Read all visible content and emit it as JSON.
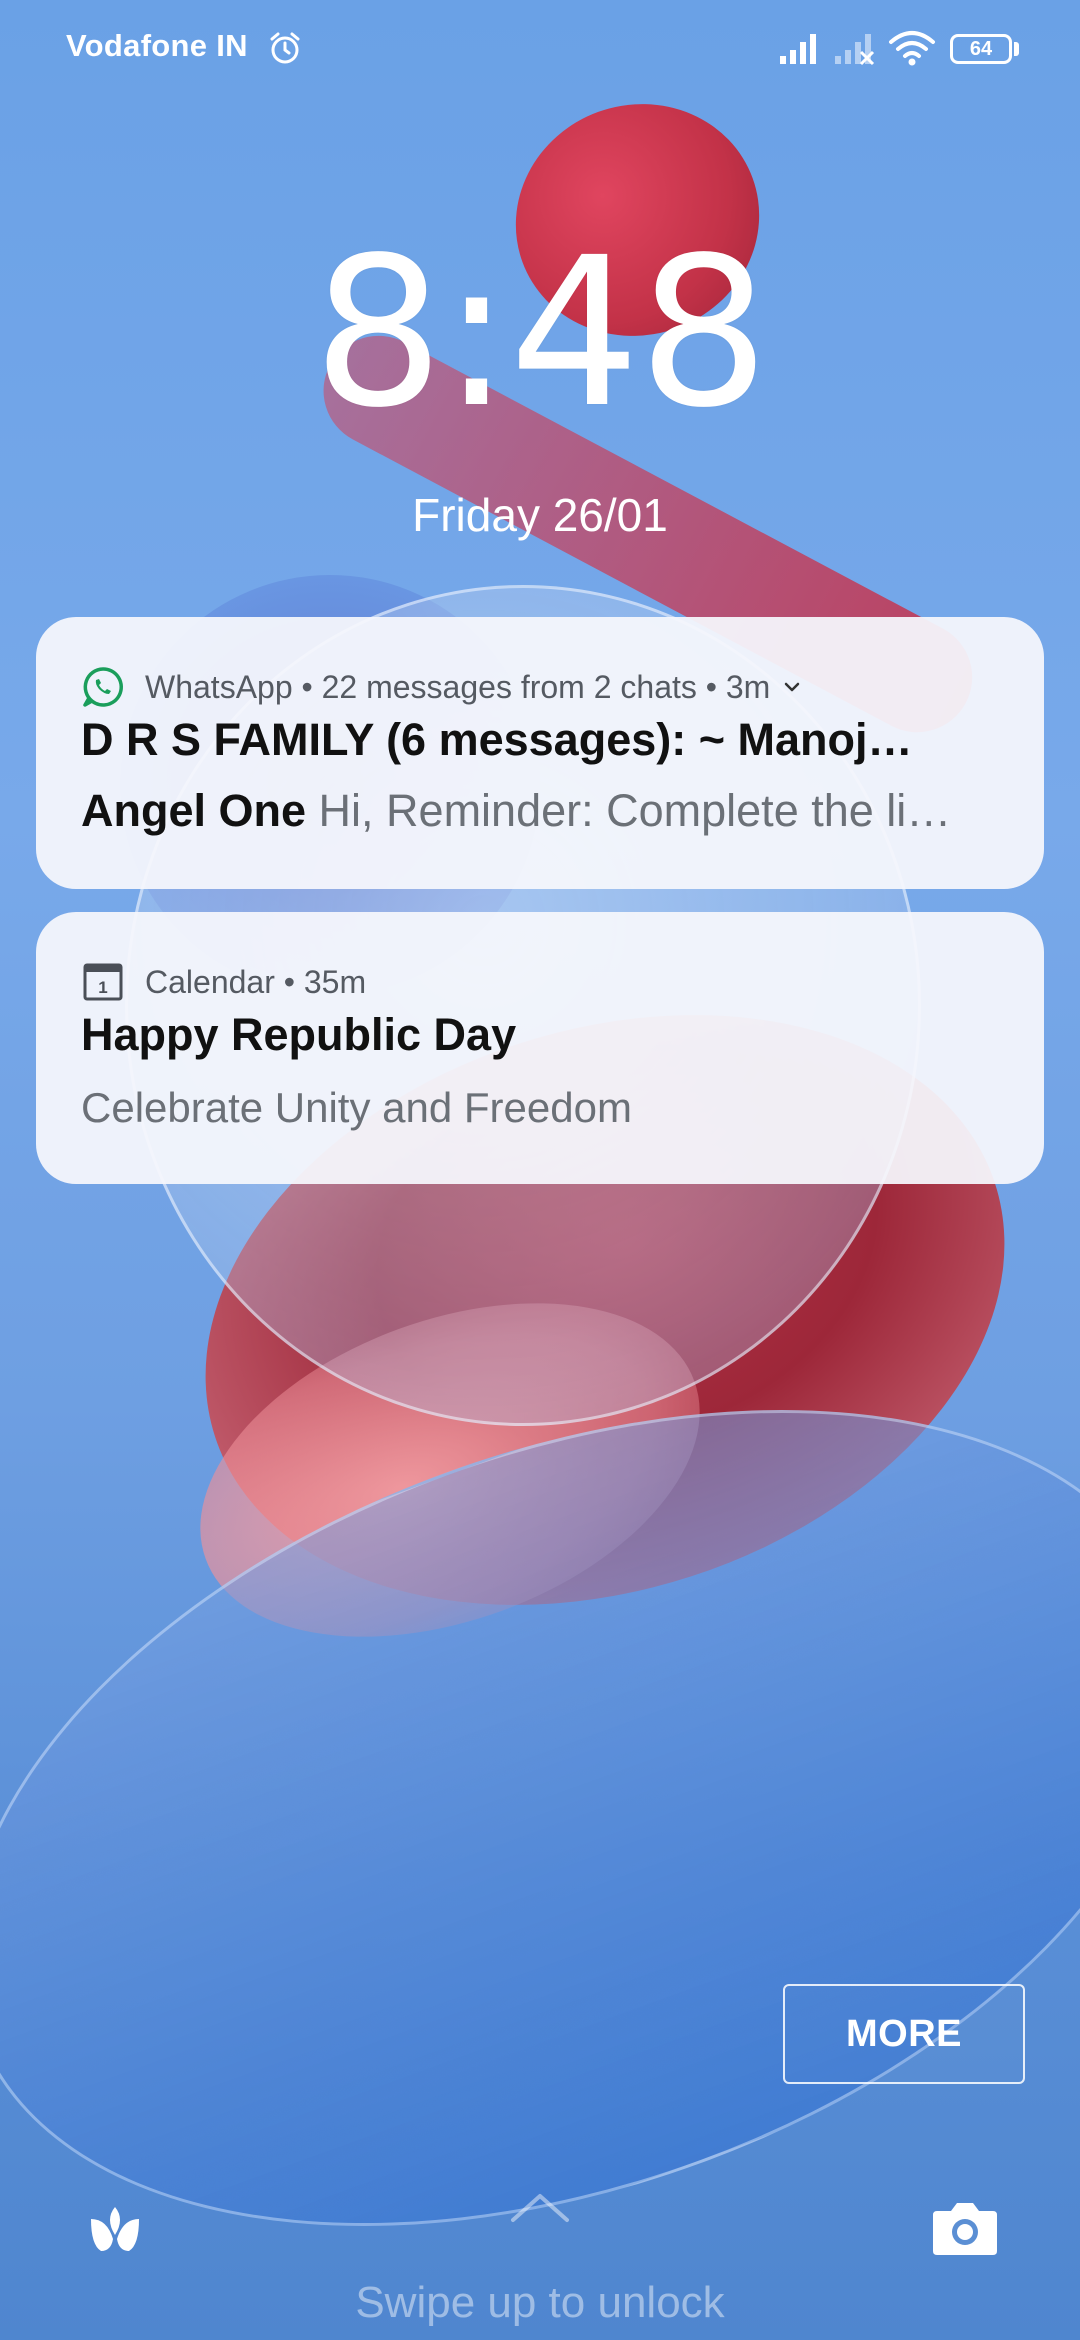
{
  "status_bar": {
    "carrier": "Vodafone IN",
    "battery": "64",
    "icons": [
      "alarm-icon",
      "signal-icon",
      "signal-no-service-icon",
      "wifi-icon",
      "battery-icon"
    ]
  },
  "lockscreen": {
    "time": "8:48",
    "date": "Friday 26/01"
  },
  "notifications": [
    {
      "app": "WhatsApp",
      "meta": "22 messages from 2 chats",
      "age": "3m",
      "accent": "#1a9e5b",
      "line1": "D R S FAMILY (6 messages): ~ Manoj…",
      "line2_sender": "Angel One",
      "line2_message": "Hi,  Reminder: Complete the li…"
    },
    {
      "app": "Calendar",
      "age": "35m",
      "title": "Happy Republic Day",
      "body": "Celebrate Unity and Freedom"
    }
  ],
  "more_button": "MORE",
  "bottom": {
    "swipe_hint": "Swipe up to unlock",
    "left_icon": "leaf-icon",
    "right_icon": "camera-icon"
  }
}
